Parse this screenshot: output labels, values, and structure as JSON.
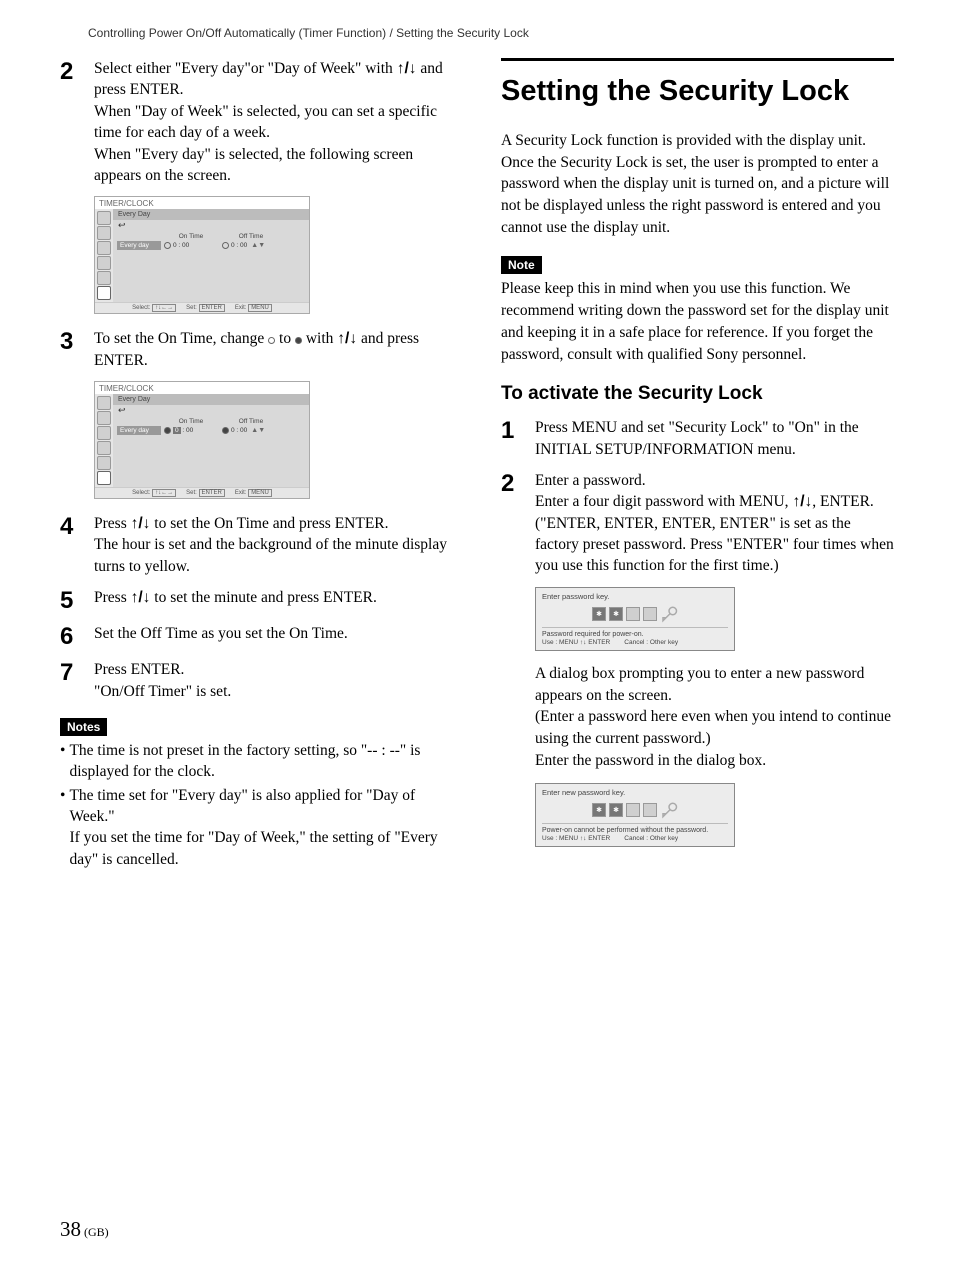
{
  "breadcrumb": "Controlling Power On/Off Automatically (Timer Function) / Setting the Security Lock",
  "left": {
    "s2": {
      "num": "2",
      "p1": "Select either \"Every day\"or \"Day of Week\" with ",
      "arrows": "↑/↓",
      "p1b": " and press ENTER.",
      "p2": "When \"Day of Week\" is selected, you can set a specific time for each day of a week.",
      "p3": "When \"Every day\" is selected, the following screen appears on the screen."
    },
    "osd": {
      "title": "TIMER/CLOCK",
      "head": "Every Day",
      "onTime": "On Time",
      "offTime": "Off Time",
      "rowLabel": "Every day",
      "t_hh": "0",
      "t_mm": "00",
      "footSelect": "Select:",
      "footSet": "Set:",
      "footExit": "Exit:",
      "kSelect": "↑↓←→",
      "kSet": "ENTER",
      "kExit": "MENU"
    },
    "s3": {
      "num": "3",
      "a": "To set the On Time, change ",
      "b": " to ",
      "c": " with ",
      "arrows": "↑/↓",
      "d": " and press ENTER."
    },
    "s4": {
      "num": "4",
      "a": "Press ",
      "arrows": "↑/↓",
      "b": " to set the On Time and press ENTER.",
      "p2": "The hour is set and the background of the minute display turns to yellow."
    },
    "s5": {
      "num": "5",
      "a": "Press ",
      "arrows": "↑/↓",
      "b": " to set the minute and press ENTER."
    },
    "s6": {
      "num": "6",
      "a": "Set the Off Time as you set the On Time."
    },
    "s7": {
      "num": "7",
      "a": "Press ENTER.",
      "b": "\"On/Off Timer\" is set."
    },
    "notesLabel": "Notes",
    "note1": "The time is not preset in the factory setting, so \"-- : --\" is displayed for the clock.",
    "note2a": "The time set for \"Every day\" is also applied for \"Day of Week.\"",
    "note2b": "If you set the time for \"Day of Week,\" the setting of \"Every day\" is cancelled."
  },
  "right": {
    "title": "Setting the Security Lock",
    "intro": "A Security Lock function is provided with the display unit. Once the Security Lock is set, the user is prompted to enter a password when the display unit is turned on, and a picture will not be displayed unless the right password is entered and you cannot use the display unit.",
    "noteLabel": "Note",
    "noteBody": "Please keep this in mind when you use this function. We recommend writing down the password set for the display unit and keeping it in a safe place for reference. If you forget the password, consult with qualified Sony personnel.",
    "subhead": "To activate the Security Lock",
    "s1": {
      "num": "1",
      "a": "Press MENU and set \"Security Lock\" to \"On\" in the INITIAL SETUP/INFORMATION menu."
    },
    "s2": {
      "num": "2",
      "a": "Enter a password.",
      "b1": "Enter a four digit password with MENU, ",
      "arrows": "↑/↓",
      "b2": ", ENTER.",
      "c": "(\"ENTER, ENTER, ENTER, ENTER\" is set as the factory preset password. Press \"ENTER\" four times when you use this function for the first time.)"
    },
    "dlg1": {
      "t1": "Enter password key.",
      "msg": "Password required for power-on.",
      "use": "Use :  MENU  ↑↓  ENTER",
      "cancel": "Cancel : Other key"
    },
    "p_after1a": "A dialog box prompting you to enter a new password appears on the screen.",
    "p_after1b": "(Enter a password here even when you intend to continue using the current password.)",
    "p_after1c": "Enter the password in the dialog box.",
    "dlg2": {
      "t1": "Enter new password key.",
      "msg": "Power-on cannot be performed without the password.",
      "use": "Use :  MENU  ↑↓  ENTER",
      "cancel": "Cancel : Other key"
    }
  },
  "page": {
    "n": "38",
    "lang": " (GB)"
  }
}
